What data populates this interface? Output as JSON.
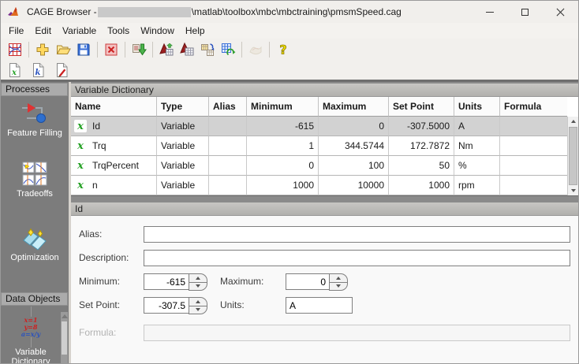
{
  "window": {
    "title_prefix": "CAGE Browser - ",
    "title_path": "\\matlab\\toolbox\\mbc\\mbctraining\\pmsmSpeed.cag"
  },
  "menu": [
    "File",
    "Edit",
    "Variable",
    "Tools",
    "Window",
    "Help"
  ],
  "toolbar_main": {
    "buttons": [
      "cage",
      "new",
      "open",
      "save",
      "delete",
      "import-data",
      "new-feature",
      "new-2d-table",
      "calibration-manager",
      "update-tables",
      "surface-viewer (disabled)",
      "help"
    ],
    "help_glyph": "?"
  },
  "toolbar_dictionary": {
    "buttons": [
      "new-variable",
      "new-constant",
      "new-formula"
    ],
    "new_variable_glyph": "x",
    "new_constant_glyph": "k"
  },
  "sidebar": {
    "sections": [
      {
        "header": "Processes",
        "items": [
          {
            "label": "Feature Filling",
            "icon": "feature-filling-icon"
          },
          {
            "label": "Tradeoffs",
            "icon": "tradeoffs-icon"
          },
          {
            "label": "Optimization",
            "icon": "optimization-icon"
          }
        ]
      },
      {
        "header": "Data Objects",
        "items": [
          {
            "label": "Variable Dictionary",
            "icon": "variable-dictionary-icon"
          }
        ]
      }
    ],
    "vd_icon_lines": [
      "x=1",
      "y=8",
      "a=x/y"
    ]
  },
  "table_panel": {
    "title": "Variable Dictionary",
    "var_glyph": "x",
    "columns": [
      "Name",
      "Type",
      "Alias",
      "Minimum",
      "Maximum",
      "Set Point",
      "Units",
      "Formula"
    ],
    "rows": [
      {
        "name": "Id",
        "type": "Variable",
        "alias": "",
        "minimum": "-615",
        "maximum": "0",
        "set_point": "-307.5000",
        "units": "A",
        "formula": "",
        "selected": true
      },
      {
        "name": "Trq",
        "type": "Variable",
        "alias": "",
        "minimum": "1",
        "maximum": "344.5744",
        "set_point": "172.7872",
        "units": "Nm",
        "formula": "",
        "selected": false
      },
      {
        "name": "TrqPercent",
        "type": "Variable",
        "alias": "",
        "minimum": "0",
        "maximum": "100",
        "set_point": "50",
        "units": "%",
        "formula": "",
        "selected": false
      },
      {
        "name": "n",
        "type": "Variable",
        "alias": "",
        "minimum": "1000",
        "maximum": "10000",
        "set_point": "1000",
        "units": "rpm",
        "formula": "",
        "selected": false
      }
    ]
  },
  "detail_panel": {
    "title": "Id",
    "alias": {
      "label": "Alias:",
      "value": ""
    },
    "description": {
      "label": "Description:",
      "value": ""
    },
    "minimum": {
      "label": "Minimum:",
      "value": "-615"
    },
    "maximum": {
      "label": "Maximum:",
      "value": "0"
    },
    "set_point": {
      "label": "Set Point:",
      "value": "-307.5"
    },
    "units": {
      "label": "Units:",
      "value": "A"
    },
    "formula": {
      "label": "Formula:",
      "value": "",
      "disabled": true
    }
  }
}
